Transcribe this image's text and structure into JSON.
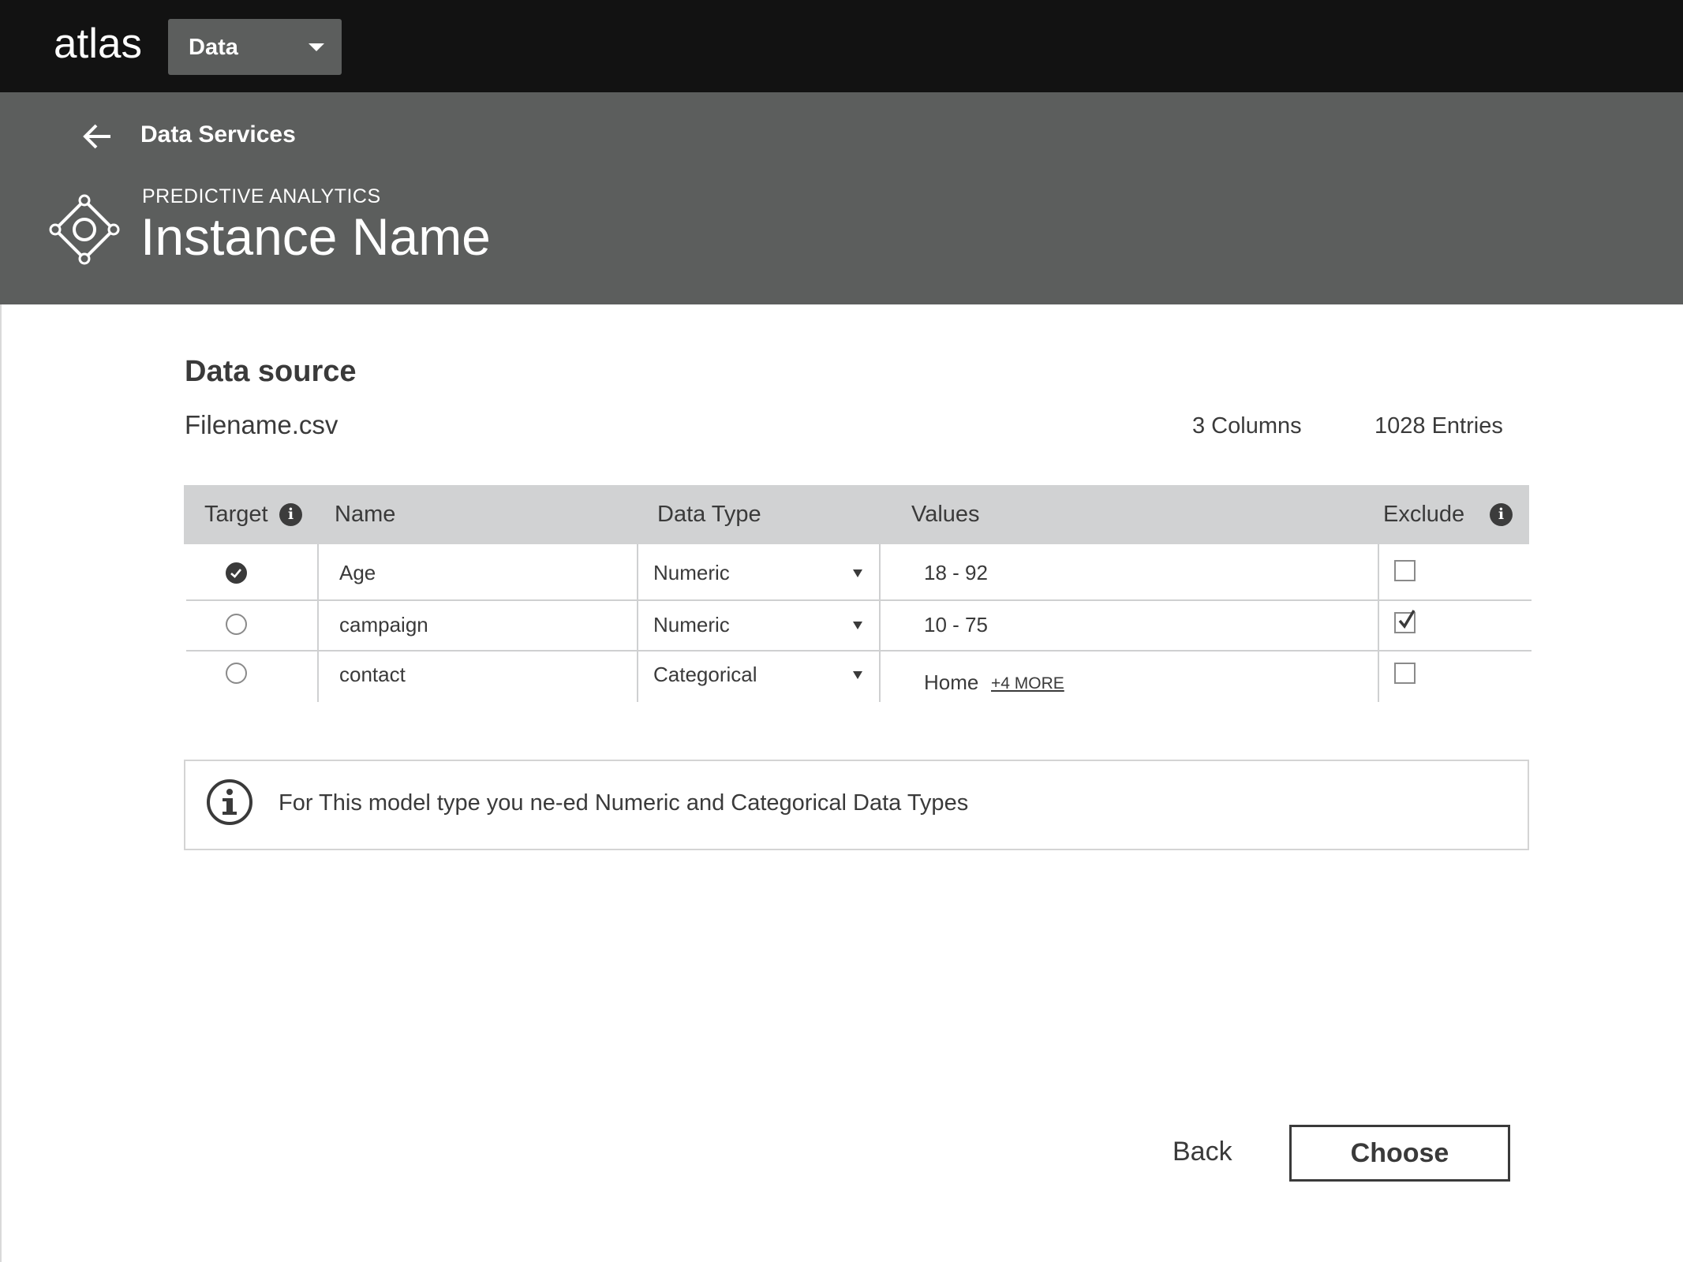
{
  "app": {
    "logo": "atlas"
  },
  "context_select": {
    "label": "Data"
  },
  "header": {
    "breadcrumb": "Data Services",
    "eyebrow": "PREDICTIVE ANALYTICS",
    "instance_name": "Instance Name",
    "icon": "service-diamond-icon"
  },
  "data_source": {
    "title": "Data source",
    "filename": "Filename.csv",
    "columns_count": "3 Columns",
    "entries_count": "1028 Entries"
  },
  "table": {
    "headers": {
      "target": "Target",
      "name": "Name",
      "data_type": "Data Type",
      "values": "Values",
      "exclude": "Exclude"
    },
    "rows": [
      {
        "target": true,
        "name": "Age",
        "data_type": "Numeric",
        "values": "18 - 92",
        "more": "",
        "exclude": false
      },
      {
        "target": false,
        "name": "campaign",
        "data_type": "Numeric",
        "values": "10 - 75",
        "more": "",
        "exclude": true
      },
      {
        "target": false,
        "name": "contact",
        "data_type": "Categorical",
        "values": "Home",
        "more": "+4 MORE",
        "exclude": false
      }
    ]
  },
  "notice": {
    "text": "For This model type you ne-ed Numeric and Categorical Data Types",
    "icon": "info-circle-icon"
  },
  "actions": {
    "back": "Back",
    "choose": "Choose"
  },
  "colors": {
    "topbar": "#121212",
    "band": "#5c5e5d",
    "table_header": "#d1d2d3",
    "text": "#3a3a3a"
  }
}
